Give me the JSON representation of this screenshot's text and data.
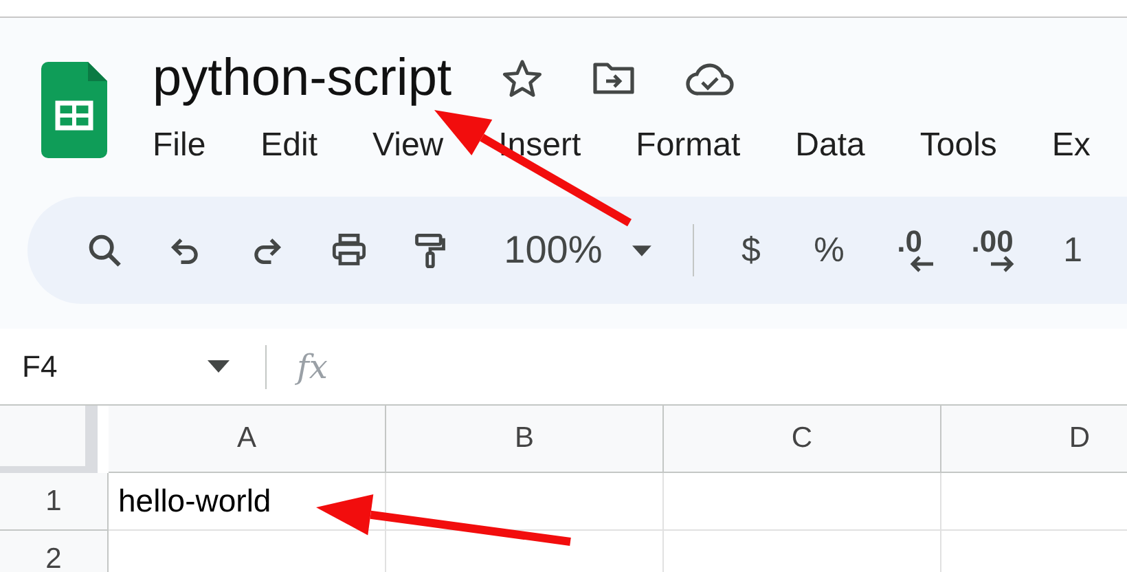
{
  "document": {
    "title": "python-script"
  },
  "menu": [
    "File",
    "Edit",
    "View",
    "Insert",
    "Format",
    "Data",
    "Tools",
    "Ex"
  ],
  "toolbar": {
    "zoom": "100%",
    "items": [
      {
        "kind": "text",
        "label": "$"
      },
      {
        "kind": "text",
        "label": "%"
      },
      {
        "kind": "decimal_decrease",
        "label": ".0"
      },
      {
        "kind": "decimal_increase",
        "label": ".00"
      },
      {
        "kind": "text",
        "label": "1"
      }
    ]
  },
  "formula_bar": {
    "cell_ref": "F4",
    "fx": "fx"
  },
  "grid": {
    "columns": [
      "A",
      "B",
      "C",
      "D"
    ],
    "rows": [
      {
        "header": "1",
        "cells": [
          "hello-world"
        ]
      },
      {
        "header": "2"
      }
    ]
  }
}
